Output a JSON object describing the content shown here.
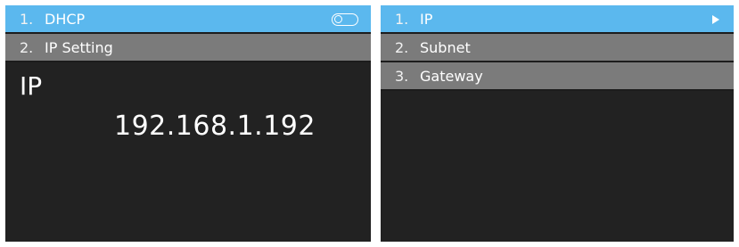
{
  "left_screen": {
    "menu": [
      {
        "number": "1.",
        "label": "DHCP",
        "toggle": "off"
      },
      {
        "number": "2.",
        "label": "IP Setting"
      }
    ],
    "field_title": "IP",
    "field_value": "192.168.1.192"
  },
  "right_screen": {
    "menu": [
      {
        "number": "1.",
        "label": "IP"
      },
      {
        "number": "2.",
        "label": "Subnet"
      },
      {
        "number": "3.",
        "label": "Gateway"
      }
    ]
  },
  "colors": {
    "selected_row": "#5bb8ee",
    "normal_row": "#7b7b7b",
    "screen_bg": "#222222",
    "text": "#ffffff"
  },
  "icons": {
    "dhcp_toggle": "toggle-switch-icon",
    "submenu_arrow": "play-arrow-icon"
  }
}
